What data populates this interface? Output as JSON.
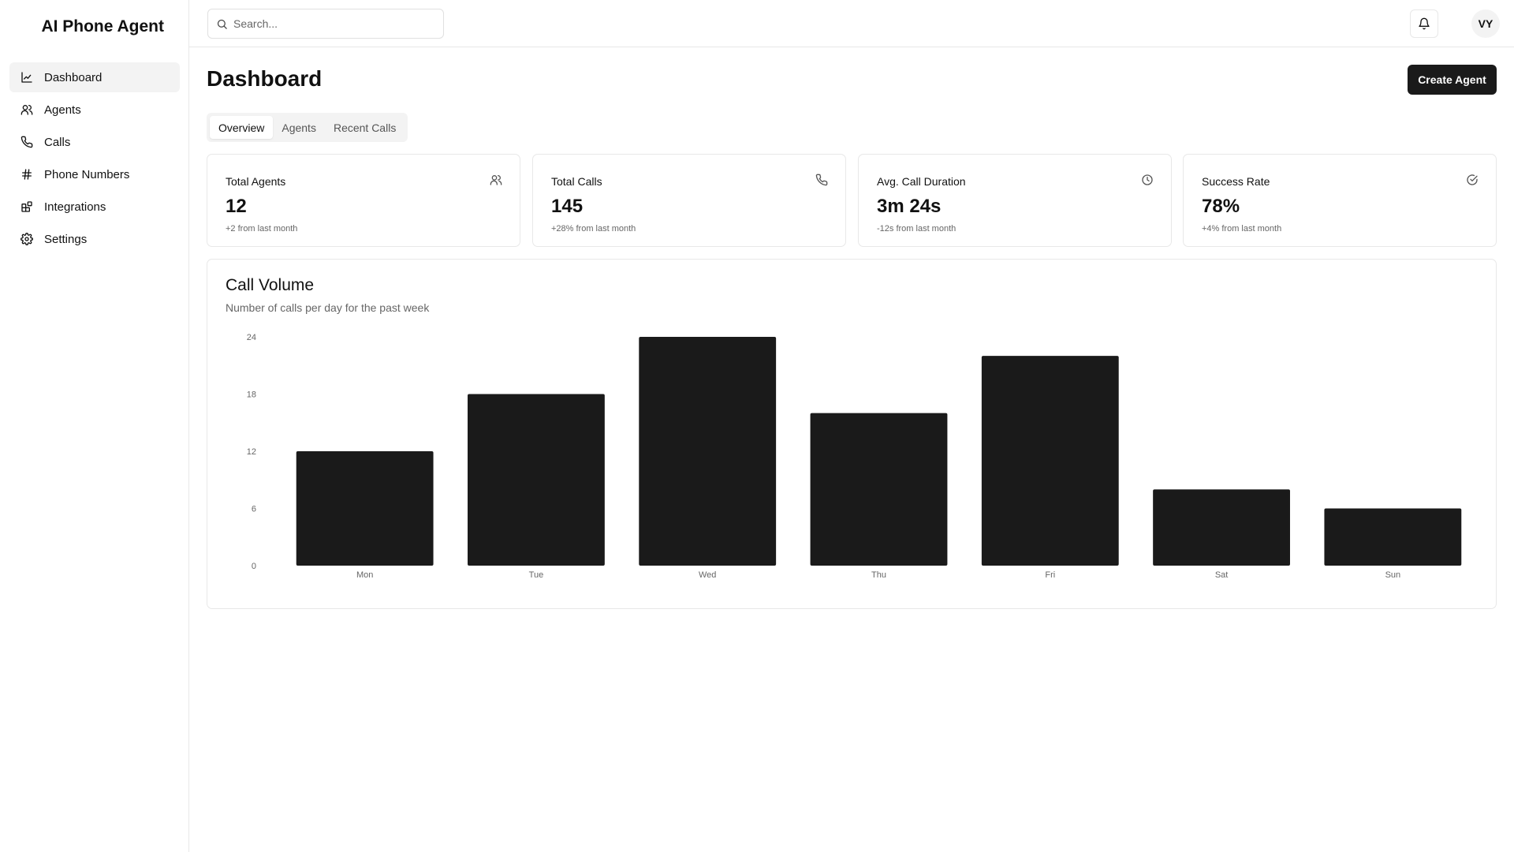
{
  "brand": {
    "title": "AI Phone Agent"
  },
  "sidebar": {
    "items": [
      {
        "label": "Dashboard",
        "icon": "chart-line-icon",
        "active": true
      },
      {
        "label": "Agents",
        "icon": "users-icon",
        "active": false
      },
      {
        "label": "Calls",
        "icon": "phone-icon",
        "active": false
      },
      {
        "label": "Phone Numbers",
        "icon": "hash-icon",
        "active": false
      },
      {
        "label": "Integrations",
        "icon": "blocks-icon",
        "active": false
      },
      {
        "label": "Settings",
        "icon": "gear-icon",
        "active": false
      }
    ]
  },
  "header": {
    "search_placeholder": "Search...",
    "avatar_initials": "VY"
  },
  "main": {
    "title": "Dashboard",
    "create_label": "Create Agent",
    "tabs": [
      {
        "label": "Overview",
        "active": true
      },
      {
        "label": "Agents",
        "active": false
      },
      {
        "label": "Recent Calls",
        "active": false
      }
    ],
    "stats": [
      {
        "label": "Total Agents",
        "value": "12",
        "sub": "+2 from last month",
        "icon": "users-icon"
      },
      {
        "label": "Total Calls",
        "value": "145",
        "sub": "+28% from last month",
        "icon": "phone-icon"
      },
      {
        "label": "Avg. Call Duration",
        "value": "3m 24s",
        "sub": "-12s from last month",
        "icon": "clock-icon"
      },
      {
        "label": "Success Rate",
        "value": "78%",
        "sub": "+4% from last month",
        "icon": "check-circle-icon"
      }
    ]
  },
  "chart_data": {
    "type": "bar",
    "title": "Call Volume",
    "subtitle": "Number of calls per day for the past week",
    "categories": [
      "Mon",
      "Tue",
      "Wed",
      "Thu",
      "Fri",
      "Sat",
      "Sun"
    ],
    "values": [
      12,
      18,
      24,
      16,
      22,
      8,
      6
    ],
    "yticks": [
      0,
      6,
      12,
      18,
      24
    ],
    "ylim": [
      0,
      24
    ],
    "grid": false,
    "bar_color": "#1a1a1a"
  }
}
